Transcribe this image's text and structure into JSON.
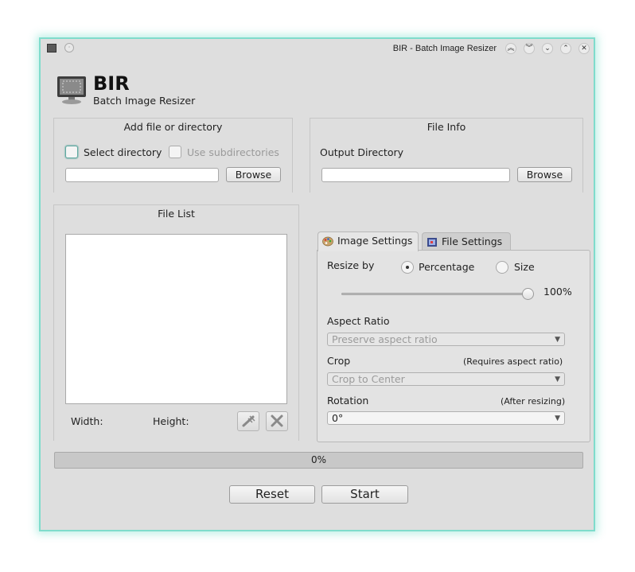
{
  "window": {
    "title": "BIR - Batch Image Resizer",
    "buttons": [
      "keep-above",
      "keep-below",
      "minimize",
      "maximize",
      "close"
    ]
  },
  "header": {
    "app_name": "BIR",
    "app_subtitle": "Batch Image Resizer"
  },
  "add_group": {
    "title": "Add file or directory",
    "select_directory_label": "Select directory",
    "use_subdirectories_label": "Use subdirectories",
    "path_value": "",
    "browse_label": "Browse"
  },
  "file_info": {
    "title": "File Info",
    "output_directory_label": "Output Directory",
    "output_value": "",
    "browse_label": "Browse"
  },
  "file_list": {
    "title": "File List",
    "width_label": "Width:",
    "height_label": "Height:",
    "items": []
  },
  "tabs": [
    {
      "label": "Image Settings",
      "icon": "palette-icon",
      "active": true
    },
    {
      "label": "File Settings",
      "icon": "file-settings-icon",
      "active": false
    }
  ],
  "image_settings": {
    "resize_by_label": "Resize by",
    "percentage_label": "Percentage",
    "size_label": "Size",
    "selected": "percentage",
    "percent_text": "100%",
    "percent_value": 100,
    "aspect_ratio_label": "Aspect Ratio",
    "aspect_ratio_value": "Preserve aspect ratio",
    "crop_label": "Crop",
    "crop_note": "(Requires aspect ratio)",
    "crop_value": "Crop to Center",
    "rotation_label": "Rotation",
    "rotation_note": "(After resizing)",
    "rotation_value": "0°"
  },
  "progress": {
    "text": "0%",
    "value": 0
  },
  "actions": {
    "reset_label": "Reset",
    "start_label": "Start"
  },
  "colors": {
    "window_border": "#7fdccc",
    "background": "#dedede"
  }
}
